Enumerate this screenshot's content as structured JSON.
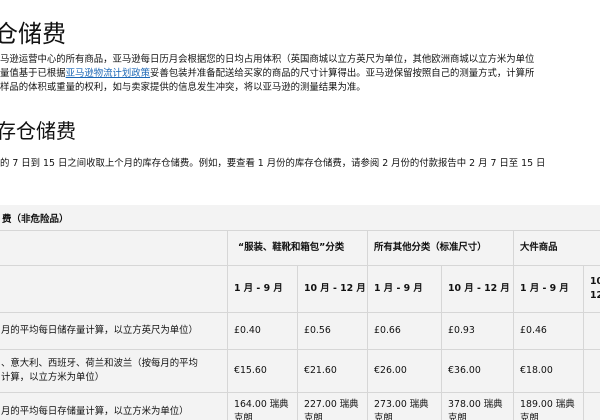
{
  "page": {
    "heading_1": "仓储费",
    "paragraph_lines": [
      "马逊运营中心的所有商品，亚马逊每日历月会根据您的日均占用体积（英国商城以立方英尺为单位，其他欧洲商城以立方米为单位",
      "量值基于已根据",
      "亚马逊物流计划政策",
      "妥善包装并准备配送给买家的商品的尺寸计算得出。亚马逊保留按照自己的测量方式，计算所",
      "样品的体积或重量的权利，如与卖家提供的信息发生冲突，将以亚马逊的测量结果为准。"
    ],
    "heading_2": "存仓储费",
    "note": "的 7 日到 15 日之间收取上个月的库存仓储费。例如，要查看 1 月份的库存仓储费，请参阅 2 月份的付款报告中 2 月 7 日至 15 日"
  },
  "fee_table": {
    "title": "费（非危险品）",
    "groups": [
      "“服装、鞋靴和箱包”分类",
      "所有其他分类（标准尺寸）",
      "大件商品"
    ],
    "periods": [
      "1 月 - 9 月",
      "10 月 - 12 月"
    ],
    "rows": [
      {
        "label": "月的平均每日储存量计算，以立方英尺为单位）",
        "cells": [
          "£0.40",
          "£0.56",
          "£0.66",
          "£0.93",
          "£0.46",
          ""
        ]
      },
      {
        "label": "、意大利、西班牙、荷兰和波兰（按每月的平均\n计算，以立方米为单位）",
        "cells": [
          "€15.60",
          "€21.60",
          "€26.00",
          "€36.00",
          "€18.00",
          ""
        ]
      },
      {
        "label": "月的平均每日存储量计算，以立方米为单位）",
        "cells": [
          "164.00 瑞典\n克朗",
          "227.00 瑞典\n克朗",
          "273.00 瑞典\n克朗",
          "378.00 瑞典\n克朗",
          "189.00 瑞典\n克朗",
          ""
        ]
      }
    ]
  },
  "colors": {
    "link": "#1a66b5",
    "table_background": "#f3f3f3",
    "border": "#d6d6d6"
  }
}
